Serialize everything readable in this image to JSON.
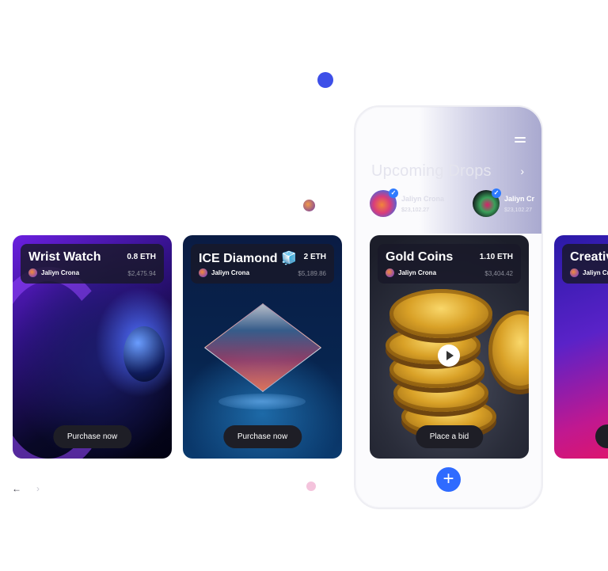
{
  "upcoming": {
    "title": "Upcoming Drops",
    "creators": [
      {
        "name": "Jaliyn Crona",
        "usd": "$23,102.27"
      },
      {
        "name": "Jaliyn Cr",
        "usd": "$23,102.27"
      }
    ]
  },
  "cards": [
    {
      "title": "Wrist Watch",
      "price": "0.8 ETH",
      "author": "Jaliyn Crona",
      "usd": "$2,475.94",
      "button": "Purchase now"
    },
    {
      "title": "ICE Diamond 🧊",
      "price": "2 ETH",
      "author": "Jaliyn Crona",
      "usd": "$5,189.86",
      "button": "Purchase now"
    },
    {
      "title": "Gold Coins",
      "price": "1.10 ETH",
      "author": "Jaliyn Crona",
      "usd": "$3,404.42",
      "button": "Place a bid"
    },
    {
      "title": "Creativ",
      "author": "Jaliyn Cr"
    }
  ],
  "fab_symbol": "+",
  "nav": {
    "prev": "←",
    "next": "›"
  },
  "icons": [
    "menu-icon",
    "chevron-right-icon",
    "verified-icon",
    "play-icon",
    "plus-icon",
    "arrow-left-icon"
  ],
  "colors": {
    "accent": "#2f6bff",
    "dot_blue": "#3d4fe8",
    "button_bg": "#1e1e26"
  }
}
